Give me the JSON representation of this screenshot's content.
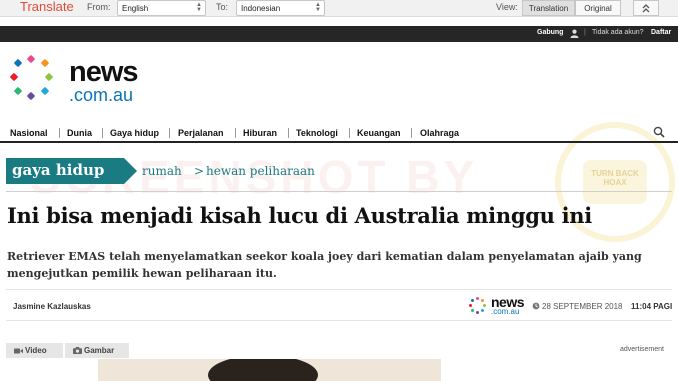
{
  "translate_bar": {
    "brand": "Translate",
    "from_label": "From:",
    "from_value": "English",
    "to_label": "To:",
    "to_value": "Indonesian",
    "view_label": "View:",
    "view_translation": "Translation",
    "view_original": "Original",
    "collapse_icon": "chevron-double-up-icon"
  },
  "login_bar": {
    "join": "Gabung",
    "no_account": "Tidak ada akun?",
    "register": "Daftar",
    "user_icon": "user-icon"
  },
  "logo": {
    "news": "news",
    "domain": ".com.au",
    "dot_colors": [
      "#e94b8a",
      "#f7931e",
      "#8cc63f",
      "#21a7d8",
      "#6a4c9c",
      "#ed1c24",
      "#2bb673",
      "#0a74b8"
    ]
  },
  "nav": {
    "items": [
      "Nasional",
      "Dunia",
      "Gaya hidup",
      "Perjalanan",
      "Hiburan",
      "Teknologi",
      "Keuangan",
      "Olahraga"
    ],
    "search_icon": "search-icon"
  },
  "section": {
    "tag": "gaya hidup",
    "crumb_parent": "rumah",
    "crumb_sep": ">",
    "crumb_child": "hewan peliharaan",
    "accent": "#1b7b82"
  },
  "article": {
    "title": "Ini bisa menjadi kisah lucu di Australia minggu ini",
    "summary": "Retriever EMAS telah menyelamatkan seekor koala joey dari kematian dalam penyelamatan ajaib yang mengejutkan pemilik hewan peliharaan itu.",
    "author": "Jasmine Kazlauskas",
    "source_logo_news": "news",
    "source_logo_domain": ".com.au",
    "date": "28 SEPTEMBER 2018",
    "time": "11:04 PAGI",
    "clock_icon": "clock-icon"
  },
  "media_tabs": {
    "video": "Video",
    "gallery": "Gambar",
    "video_icon": "video-camera-icon",
    "gallery_icon": "camera-icon"
  },
  "advert_label": "advertisement",
  "watermark": "SCREENSHOT BY",
  "stamp_text": "TURN BACK HOAX"
}
